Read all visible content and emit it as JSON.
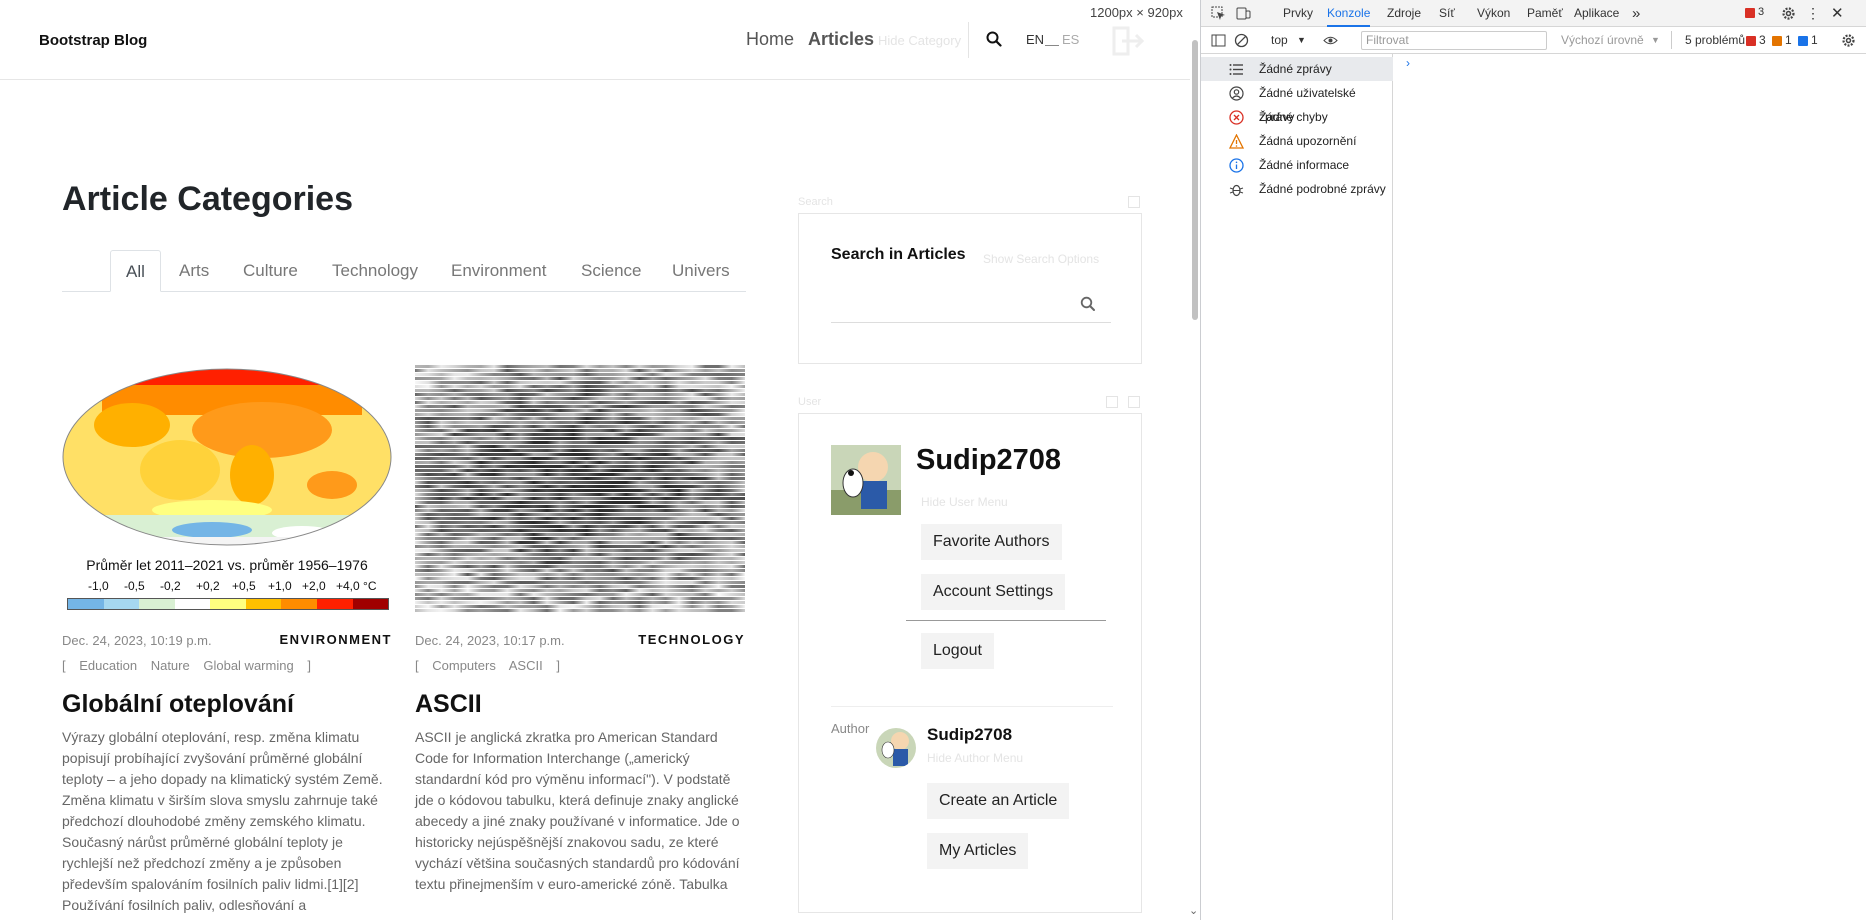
{
  "viewport_badge": "1200px × 920px",
  "navbar": {
    "brand": "Bootstrap Blog",
    "home": "Home",
    "articles": "Articles",
    "hide_category": "Hide Category",
    "lang_en": "EN",
    "lang_es": "ES"
  },
  "categories": {
    "heading": "Article Categories",
    "tabs": [
      "All",
      "Arts",
      "Culture",
      "Technology",
      "Environment",
      "Science",
      "Univers"
    ],
    "active_tab": "All"
  },
  "articles": [
    {
      "date": "Dec. 24, 2023, 10:19 p.m.",
      "category": "ENVIRONMENT",
      "tags": [
        "Education",
        "Nature",
        "Global warming"
      ],
      "title": "Globální oteplování",
      "text": "Výrazy globální oteplování, resp. změna klimatu popisují probíhající zvyšování průměrné globální teploty – a jeho dopady na klimatický systém Země. Změna klimatu v širším slova smyslu zahrnuje také předchozí dlouhodobé změny zemského klimatu. Současný nárůst průměrné globální teploty je rychlejší než předchozí změny a je způsoben především spalováním fosilních paliv lidmi.[1][2] Používání fosilních paliv, odlesňování a",
      "image": {
        "caption": "Průměr let 2011–2021 vs. průměr 1956–1976",
        "scale": [
          "-1,0",
          "-0,5",
          "-0,2",
          "+0,2",
          "+0,5",
          "+1,0",
          "+2,0",
          "+4,0 °C"
        ],
        "scale_colors": [
          "#74b5e6",
          "#a6d8f0",
          "#d9f0d3",
          "#ffffff",
          "#ffff80",
          "#ffc000",
          "#ff8c00",
          "#ff2000",
          "#a00000"
        ]
      }
    },
    {
      "date": "Dec. 24, 2023, 10:17 p.m.",
      "category": "TECHNOLOGY",
      "tags": [
        "Computers",
        "ASCII"
      ],
      "title": "ASCII",
      "text": "ASCII je anglická zkratka pro American Standard Code for Information Interchange („americký standardní kód pro výměnu informací\"). V podstatě jde o kódovou tabulku, která definuje znaky anglické abecedy a jiné znaky používané v informatice. Jde o historicky nejúspěšnější znakovou sadu, ze které vychází většina současných standardů pro kódování textu přinejmenším v euro-americké zóně. Tabulka"
    }
  ],
  "search_widget": {
    "label": "Search",
    "title": "Search in Articles",
    "hint": "Show Search Options"
  },
  "user_widget": {
    "label": "User",
    "username": "Sudip2708",
    "hide_menu": "Hide User Menu",
    "buttons": [
      "Favorite Authors",
      "Account Settings"
    ],
    "logout": "Logout",
    "author_label": "Author",
    "author_name": "Sudip2708",
    "hide_author_menu": "Hide Author Menu",
    "author_buttons": [
      "Create an Article",
      "My Articles"
    ]
  },
  "devtools": {
    "tabs": [
      "Prvky",
      "Konzole",
      "Zdroje",
      "Síť",
      "Výkon",
      "Paměť",
      "Aplikace"
    ],
    "active_tab": "Konzole",
    "more": "»",
    "error_count": "3",
    "context": "top",
    "filter_placeholder": "Filtrovat",
    "levels": "Výchozí úrovně",
    "problems_label": "5 problémů:",
    "problems_errors": "3",
    "problems_warnings": "1",
    "problems_info": "1",
    "sidebar": [
      {
        "icon": "list-icon",
        "label": "Žádné zprávy",
        "selected": true
      },
      {
        "icon": "user-circle-icon",
        "label": "Žádné uživatelské zprávy",
        "selected": false
      },
      {
        "icon": "error-icon",
        "label": "Žádné chyby",
        "selected": false
      },
      {
        "icon": "warning-icon",
        "label": "Žádná upozornění",
        "selected": false
      },
      {
        "icon": "info-icon",
        "label": "Žádné informace",
        "selected": false
      },
      {
        "icon": "bug-icon",
        "label": "Žádné podrobné zprávy",
        "selected": false
      }
    ],
    "colors": {
      "accent": "#1a73e8",
      "error": "#d93025",
      "warning": "#e37400"
    }
  }
}
